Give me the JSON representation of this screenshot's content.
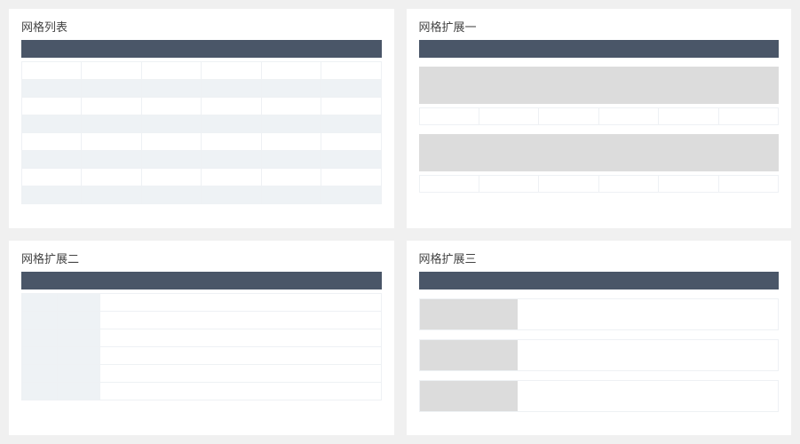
{
  "panelA": {
    "title": "网格列表",
    "columns": 6,
    "rows": [
      [
        "",
        "",
        "",
        "",
        "",
        ""
      ],
      [
        "",
        "",
        "",
        "",
        "",
        ""
      ],
      [
        "",
        "",
        "",
        "",
        "",
        ""
      ],
      [
        "",
        "",
        "",
        "",
        "",
        ""
      ],
      [
        "",
        "",
        "",
        "",
        "",
        ""
      ],
      [
        "",
        "",
        "",
        "",
        "",
        ""
      ],
      [
        "",
        "",
        "",
        "",
        "",
        ""
      ],
      [
        "",
        "",
        "",
        "",
        "",
        ""
      ]
    ]
  },
  "panelB": {
    "title": "网格扩展一",
    "groups": [
      {
        "block": "",
        "cells": [
          "",
          "",
          "",
          "",
          "",
          ""
        ]
      },
      {
        "block": "",
        "cells": [
          "",
          "",
          "",
          "",
          "",
          ""
        ]
      }
    ]
  },
  "panelC": {
    "title": "网格扩展二",
    "rows": [
      {
        "label1": "",
        "label2": "",
        "content": ""
      },
      {
        "label1": "",
        "label2": "",
        "content": ""
      },
      {
        "label1": "",
        "label2": "",
        "content": ""
      },
      {
        "label1": "",
        "label2": "",
        "content": ""
      },
      {
        "label1": "",
        "label2": "",
        "content": ""
      },
      {
        "label1": "",
        "label2": "",
        "content": ""
      }
    ]
  },
  "panelD": {
    "title": "网格扩展三",
    "rows": [
      {
        "thumb": "",
        "content": ""
      },
      {
        "thumb": "",
        "content": ""
      },
      {
        "thumb": "",
        "content": ""
      }
    ]
  },
  "colors": {
    "headerBar": "#4a5668",
    "altRow": "#eef2f5",
    "block": "#dcdcdc",
    "border": "#eef1f4",
    "pageBg": "#f0f0f0",
    "panelBg": "#ffffff"
  }
}
